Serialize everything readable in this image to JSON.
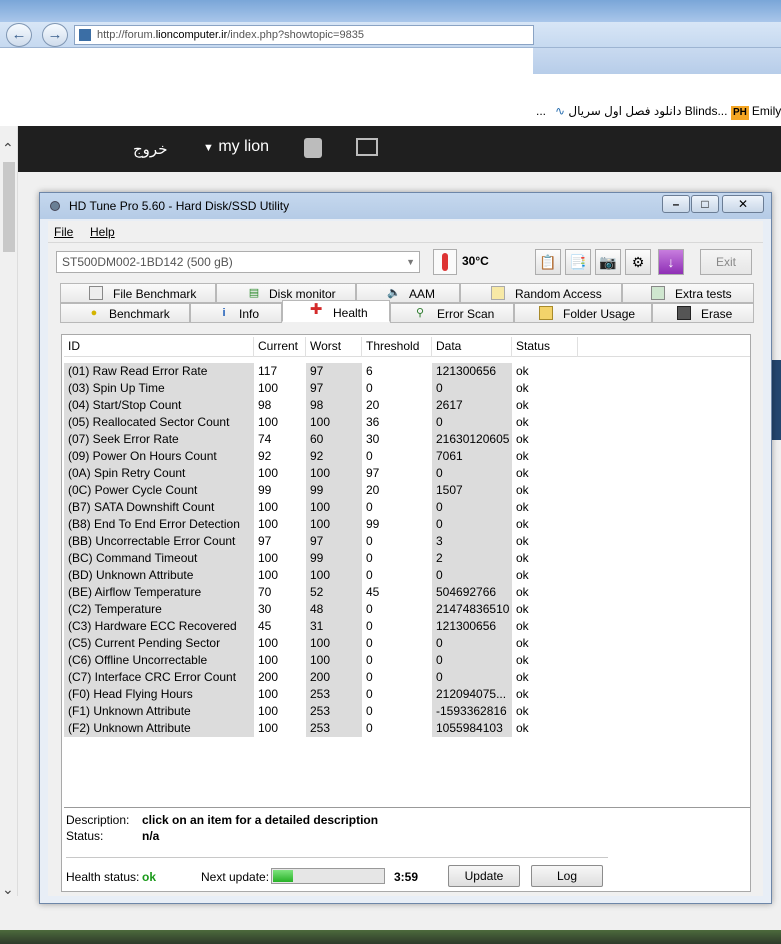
{
  "browser": {
    "url_prefix": "http://forum.",
    "url_host": "lioncomputer.ir",
    "url_path": "/index.php?showtopic=9835",
    "favorites": [
      {
        "label": "...",
        "icon": "none"
      },
      {
        "label": "دانلود فصل اول سریال Blinds...",
        "icon": "swirl-icon"
      },
      {
        "label": "Emily",
        "badge": "PH"
      }
    ]
  },
  "forum": {
    "logout_label": "خروج",
    "user_label": "my lion"
  },
  "window": {
    "title": "HD Tune Pro 5.60 - Hard Disk/SSD Utility",
    "controls": [
      "–",
      "□",
      "✕"
    ]
  },
  "menu": {
    "file": "File",
    "help": "Help"
  },
  "toolbar": {
    "drive": "ST500DM002-1BD142 (500 gB)",
    "temperature": "30°C",
    "exit_label": "Exit"
  },
  "tabs_top": [
    {
      "label": "File Benchmark",
      "icon": "file-benchmark-icon"
    },
    {
      "label": "Disk monitor",
      "icon": "disk-monitor-icon"
    },
    {
      "label": "AAM",
      "icon": "speaker-icon"
    },
    {
      "label": "Random Access",
      "icon": "random-access-icon"
    },
    {
      "label": "Extra tests",
      "icon": "extra-tests-icon"
    }
  ],
  "tabs_bottom": [
    {
      "label": "Benchmark",
      "icon": "lightbulb-icon"
    },
    {
      "label": "Info",
      "icon": "info-icon"
    },
    {
      "label": "Health",
      "icon": "health-cross-icon",
      "active": true
    },
    {
      "label": "Error Scan",
      "icon": "magnifier-icon"
    },
    {
      "label": "Folder Usage",
      "icon": "folder-icon"
    },
    {
      "label": "Erase",
      "icon": "trash-icon"
    }
  ],
  "table": {
    "headers": [
      "ID",
      "Current",
      "Worst",
      "Threshold",
      "Data",
      "Status"
    ],
    "rows": [
      [
        "(01) Raw Read Error Rate",
        "117",
        "97",
        "6",
        "121300656",
        "ok"
      ],
      [
        "(03) Spin Up Time",
        "100",
        "97",
        "0",
        "0",
        "ok"
      ],
      [
        "(04) Start/Stop Count",
        "98",
        "98",
        "20",
        "2617",
        "ok"
      ],
      [
        "(05) Reallocated Sector Count",
        "100",
        "100",
        "36",
        "0",
        "ok"
      ],
      [
        "(07) Seek Error Rate",
        "74",
        "60",
        "30",
        "21630120605",
        "ok"
      ],
      [
        "(09) Power On Hours Count",
        "92",
        "92",
        "0",
        "7061",
        "ok"
      ],
      [
        "(0A) Spin Retry Count",
        "100",
        "100",
        "97",
        "0",
        "ok"
      ],
      [
        "(0C) Power Cycle Count",
        "99",
        "99",
        "20",
        "1507",
        "ok"
      ],
      [
        "(B7) SATA Downshift Count",
        "100",
        "100",
        "0",
        "0",
        "ok"
      ],
      [
        "(B8) End To End Error Detection",
        "100",
        "100",
        "99",
        "0",
        "ok"
      ],
      [
        "(BB) Uncorrectable Error Count",
        "97",
        "97",
        "0",
        "3",
        "ok"
      ],
      [
        "(BC) Command Timeout",
        "100",
        "99",
        "0",
        "2",
        "ok"
      ],
      [
        "(BD) Unknown Attribute",
        "100",
        "100",
        "0",
        "0",
        "ok"
      ],
      [
        "(BE) Airflow Temperature",
        "70",
        "52",
        "45",
        "504692766",
        "ok"
      ],
      [
        "(C2) Temperature",
        "30",
        "48",
        "0",
        "21474836510",
        "ok"
      ],
      [
        "(C3) Hardware ECC Recovered",
        "45",
        "31",
        "0",
        "121300656",
        "ok"
      ],
      [
        "(C5) Current Pending Sector",
        "100",
        "100",
        "0",
        "0",
        "ok"
      ],
      [
        "(C6) Offline Uncorrectable",
        "100",
        "100",
        "0",
        "0",
        "ok"
      ],
      [
        "(C7) Interface CRC Error Count",
        "200",
        "200",
        "0",
        "0",
        "ok"
      ],
      [
        "(F0) Head Flying Hours",
        "100",
        "253",
        "0",
        "212094075...",
        "ok"
      ],
      [
        "(F1) Unknown Attribute",
        "100",
        "253",
        "0",
        "-1593362816",
        "ok"
      ],
      [
        "(F2) Unknown Attribute",
        "100",
        "253",
        "0",
        "1055984103",
        "ok"
      ]
    ]
  },
  "details": {
    "description_label": "Description:",
    "description_value": "click on an item for a detailed description",
    "status_label": "Status:",
    "status_value": "n/a",
    "health_label": "Health status:",
    "health_value": "ok",
    "next_update_label": "Next update:",
    "next_update_progress": 0.18,
    "timer": "3:59",
    "update_label": "Update",
    "log_label": "Log"
  }
}
